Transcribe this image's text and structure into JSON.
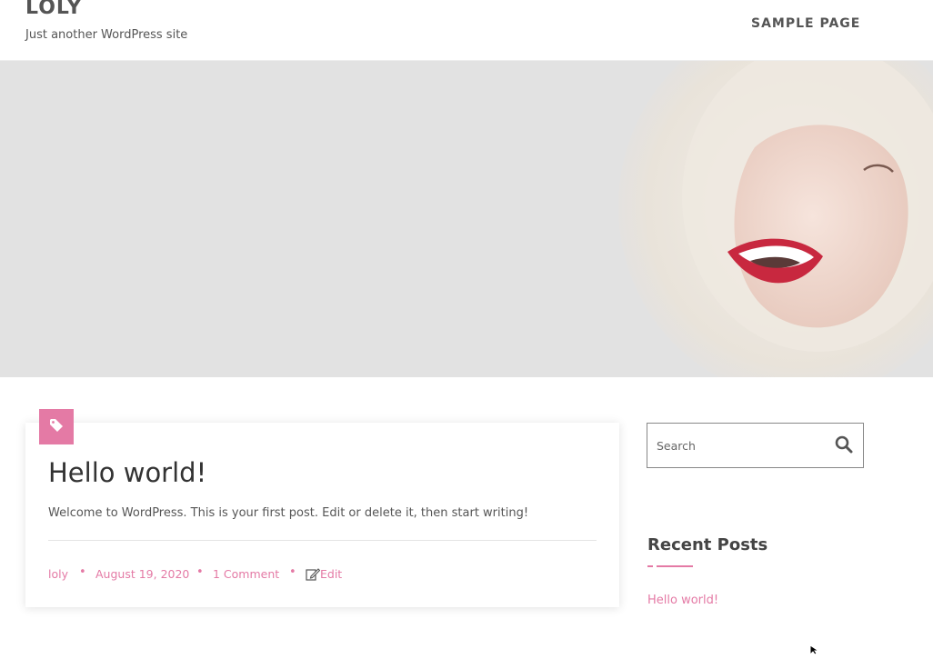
{
  "header": {
    "site_title": "LOLY",
    "tagline": "Just another WordPress site",
    "nav": [
      {
        "label": "SAMPLE PAGE"
      }
    ]
  },
  "post": {
    "title": "Hello world!",
    "excerpt": "Welcome to WordPress. This is your first post. Edit or delete it, then start writing!",
    "meta": {
      "author": "loly",
      "date": "August 19, 2020",
      "comments": "1 Comment",
      "edit": "Edit",
      "separator": "•"
    },
    "badge_icon": "tag-icon"
  },
  "sidebar": {
    "search": {
      "placeholder": "Search",
      "value": "",
      "icon": "search-icon"
    },
    "recent_posts": {
      "title": "Recent Posts",
      "items": [
        {
          "label": "Hello world!"
        }
      ]
    }
  },
  "colors": {
    "accent": "#e47aa5",
    "text": "#444444",
    "hero_bg": "#e2e2e2"
  }
}
